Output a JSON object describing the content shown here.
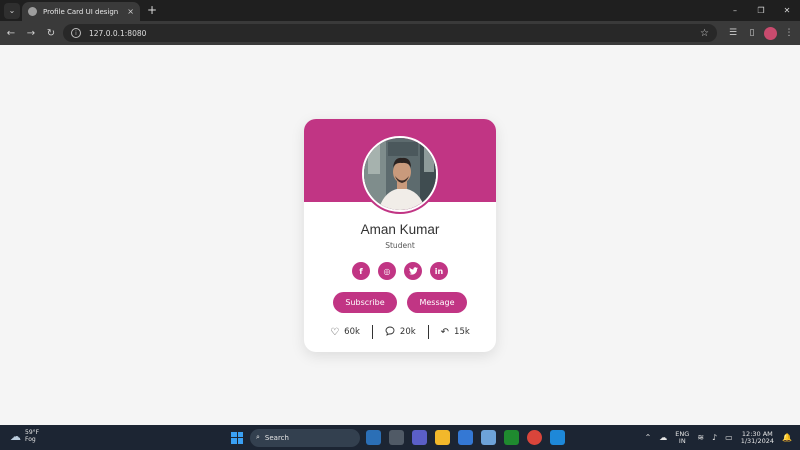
{
  "browser": {
    "tab_title": "Profile Card UI design",
    "tab_close": "×",
    "new_tab": "+",
    "url": "127.0.0.1:8080",
    "win_min": "–",
    "win_max": "❐",
    "win_close": "✕"
  },
  "profile": {
    "name": "Aman Kumar",
    "role": "Student",
    "socials": [
      {
        "network": "facebook",
        "glyph": "f"
      },
      {
        "network": "instagram",
        "glyph": "◎"
      },
      {
        "network": "twitter",
        "glyph": "♥"
      },
      {
        "network": "linkedin",
        "glyph": "in"
      }
    ],
    "buttons": {
      "subscribe": "Subscribe",
      "message": "Message"
    },
    "stats": {
      "likes": "60k",
      "comments": "20k",
      "shares": "15k"
    }
  },
  "taskbar": {
    "weather_temp": "59°F",
    "weather_desc": "Fog",
    "search_label": "Search",
    "lang_top": "ENG",
    "lang_bottom": "IN",
    "time": "12:30 AM",
    "date": "1/31/2024"
  },
  "colors": {
    "accent": "#c13584",
    "page_bg": "#f5f5f5",
    "card_bg": "#ffffff"
  }
}
